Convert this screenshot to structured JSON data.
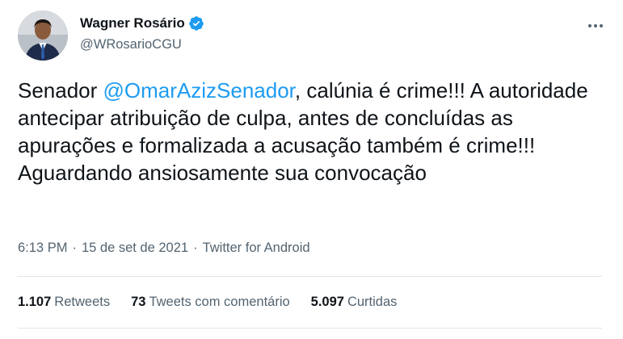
{
  "author": {
    "name": "Wagner Rosário",
    "handle": "@WRosarioCGU",
    "verified": true
  },
  "tweet": {
    "before_mention": "Senador ",
    "mention": "@OmarAzizSenador",
    "after_mention": ", calúnia é crime!!! A autoridade antecipar atribuição de culpa, antes de concluídas as apurações e formalizada a acusação também é crime!!! Aguardando ansiosamente sua convocação"
  },
  "meta": {
    "time": "6:13 PM",
    "separator": "·",
    "date": "15 de set de 2021",
    "source": "Twitter for Android"
  },
  "stats": {
    "retweets_count": "1.107",
    "retweets_label": "Retweets",
    "quotes_count": "73",
    "quotes_label": "Tweets com comentário",
    "likes_count": "5.097",
    "likes_label": "Curtidas"
  },
  "colors": {
    "accent": "#1d9bf0",
    "secondary_text": "#536471",
    "divider": "#e1e6ea"
  },
  "icons": {
    "verified": "verified-badge-icon",
    "more": "more-dots-icon"
  }
}
